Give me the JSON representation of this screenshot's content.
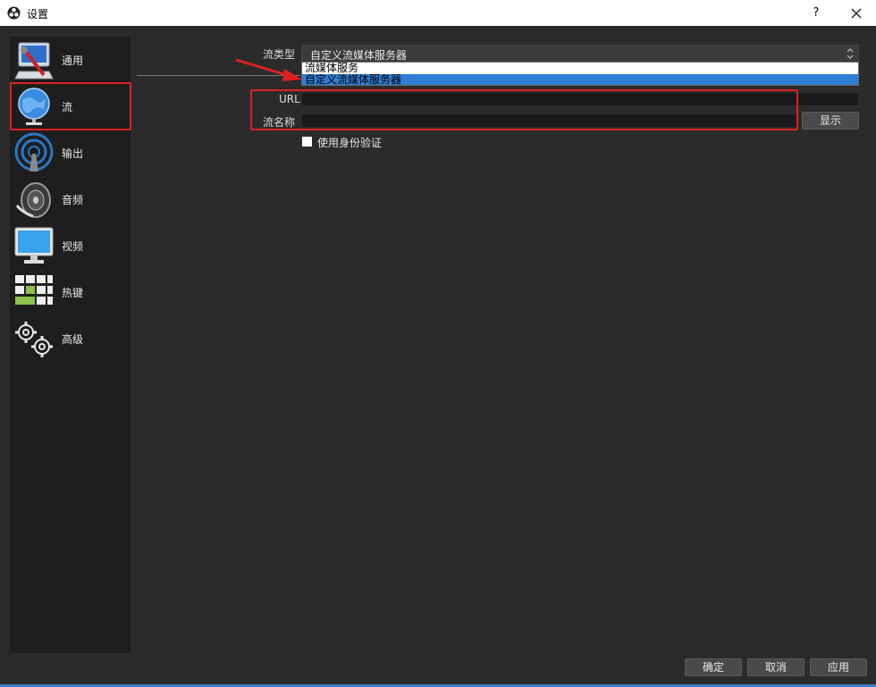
{
  "window": {
    "title": "设置",
    "help_label": "?"
  },
  "sidebar": {
    "items": [
      {
        "label": "通用",
        "icon": "general-icon"
      },
      {
        "label": "流",
        "icon": "stream-globe-icon"
      },
      {
        "label": "输出",
        "icon": "output-antenna-icon"
      },
      {
        "label": "音频",
        "icon": "audio-speaker-icon"
      },
      {
        "label": "视频",
        "icon": "video-monitor-icon"
      },
      {
        "label": "热键",
        "icon": "hotkeys-keyboard-icon"
      },
      {
        "label": "高级",
        "icon": "advanced-gears-icon"
      }
    ],
    "selected_index": 1
  },
  "stream": {
    "type_label": "流类型",
    "type_value": "自定义流媒体服务器",
    "dropdown_options": [
      "流媒体服务",
      "自定义流媒体服务器"
    ],
    "dropdown_highlighted": 1,
    "url_label": "URL",
    "url_value": "",
    "key_label": "流名称",
    "key_value": "",
    "show_button": "显示",
    "auth_label": "使用身份验证"
  },
  "footer": {
    "ok": "确定",
    "cancel": "取消",
    "apply": "应用"
  },
  "colors": {
    "annotation": "#e02020",
    "highlight": "#2f7dd6",
    "accent_strip": "#3c7fc6"
  }
}
